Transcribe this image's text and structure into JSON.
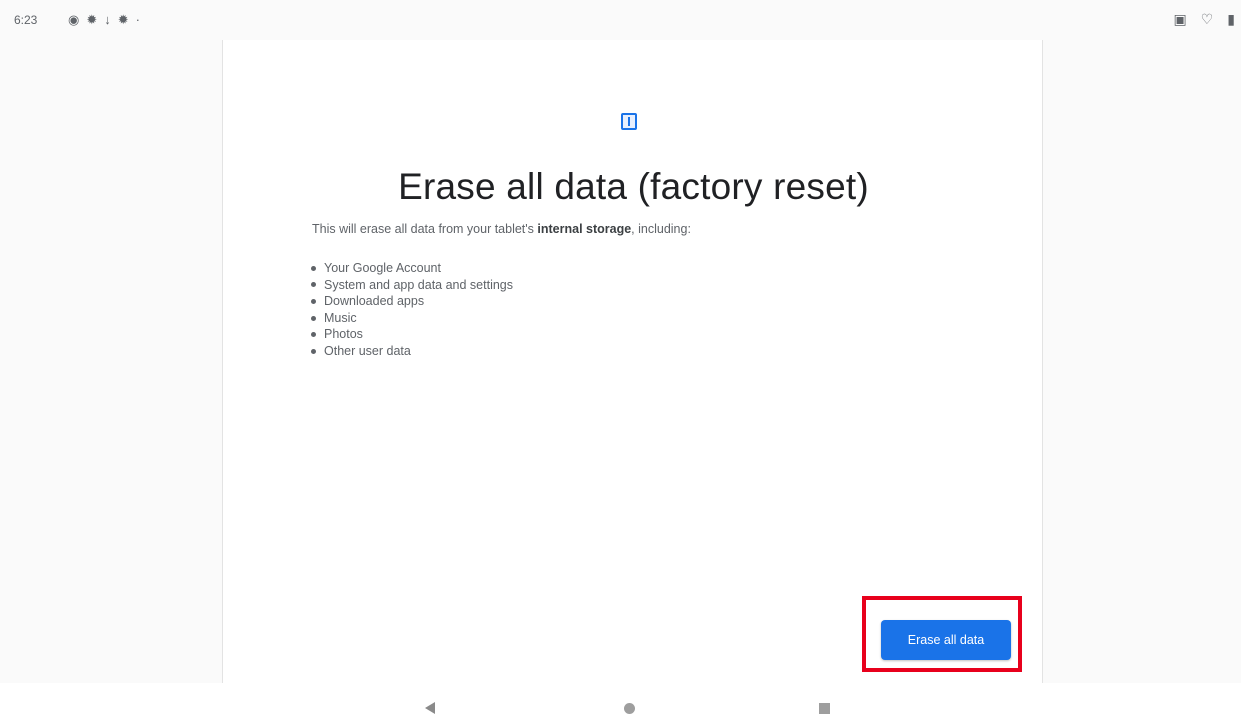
{
  "status_bar": {
    "time": "6:23",
    "left_icons": [
      "notification-icon",
      "gear-icon",
      "download-icon",
      "gear-icon",
      "dot-icon"
    ],
    "right_icons": [
      "nfc-icon",
      "wifi-icon",
      "battery-icon"
    ]
  },
  "screen": {
    "title": "Erase all data (factory reset)",
    "description_prefix": "This will erase all data from your tablet's ",
    "description_bold": "internal storage",
    "description_suffix": ", including:",
    "items": [
      "Your Google Account",
      "System and app data and settings",
      "Downloaded apps",
      "Music",
      "Photos",
      "Other user data"
    ],
    "erase_button_label": "Erase all data"
  },
  "highlight": {
    "color": "#e8001c"
  },
  "colors": {
    "accent": "#1a73e8"
  }
}
